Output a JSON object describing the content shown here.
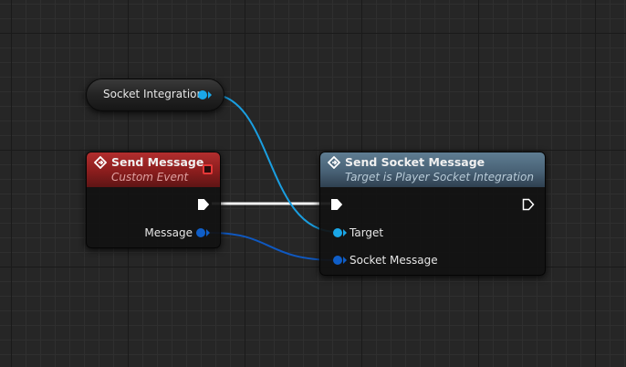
{
  "graph": {
    "variable_node": {
      "label": "Socket Integration",
      "pin_color": "#1aa7e8"
    },
    "event_node": {
      "title": "Send Message",
      "subtitle": "Custom Event",
      "header_color": "#9a2323",
      "icon": "event-diamond-icon",
      "delegate_icon": "delegate-square-icon",
      "output_pins": [
        {
          "label": "Message",
          "type": "string",
          "color": "#0f5ec8"
        }
      ]
    },
    "function_node": {
      "title": "Send Socket Message",
      "subtitle": "Target is Player Socket Integration",
      "header_color": "#4d6779",
      "icon": "function-diamond-icon",
      "input_pins": [
        {
          "label": "Target",
          "type": "object",
          "color": "#1aa7e8"
        },
        {
          "label": "Socket Message",
          "type": "string",
          "color": "#0f5ec8"
        }
      ]
    },
    "wires": [
      {
        "from": "event_node.exec_out",
        "to": "function_node.exec_in",
        "type": "exec",
        "color": "#ffffff"
      },
      {
        "from": "variable_node.out",
        "to": "function_node.Target",
        "type": "object",
        "color": "#1aa7e8"
      },
      {
        "from": "event_node.Message",
        "to": "function_node.Socket Message",
        "type": "string",
        "color": "#0f5ec8"
      }
    ]
  }
}
